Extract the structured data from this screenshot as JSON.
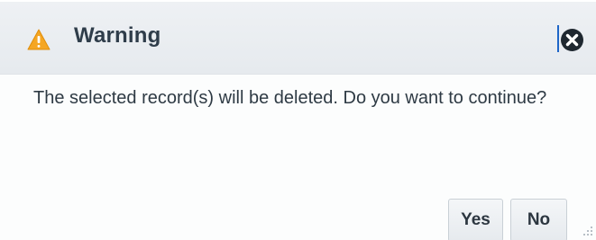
{
  "dialog": {
    "title": "Warning",
    "icon": "warning-triangle-icon",
    "icon_color": "#f5a623",
    "close_icon": "close-circle-icon",
    "message": "The selected record(s) will be deleted. Do you want to continue?",
    "buttons": {
      "yes_label": "Yes",
      "no_label": "No"
    },
    "colors": {
      "title_bar": "#e9edf1",
      "text": "#2e3a44",
      "caret": "#1e66c8"
    }
  }
}
